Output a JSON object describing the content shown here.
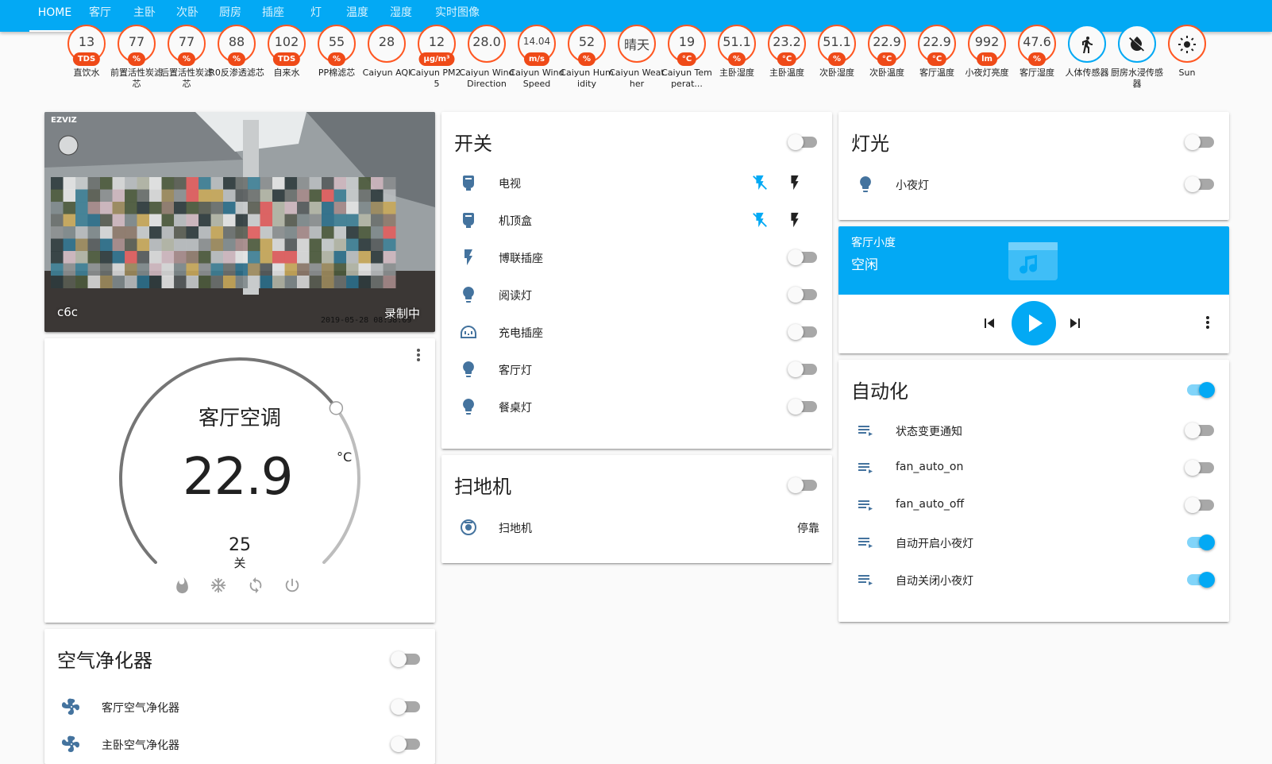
{
  "tabs": [
    "HOME",
    "客厅",
    "主卧",
    "次卧",
    "厨房",
    "插座",
    "灯",
    "温度",
    "湿度",
    "实时图像"
  ],
  "badges": [
    {
      "value": "13",
      "unit": "TDS",
      "label": "直饮水"
    },
    {
      "value": "77",
      "unit": "%",
      "label": "前置活性炭滤芯"
    },
    {
      "value": "77",
      "unit": "%",
      "label": "后置活性炭滤芯"
    },
    {
      "value": "88",
      "unit": "%",
      "label": "R0反渗透滤芯"
    },
    {
      "value": "102",
      "unit": "TDS",
      "label": "自来水"
    },
    {
      "value": "55",
      "unit": "%",
      "label": "PP棉滤芯"
    },
    {
      "value": "28",
      "unit": "",
      "label": "Caiyun AQI"
    },
    {
      "value": "12",
      "unit": "μg/m³",
      "label": "Caiyun PM2.5"
    },
    {
      "value": "28.0",
      "unit": "",
      "label": "Caiyun Wind Direction"
    },
    {
      "value": "14.04",
      "unit": "m/s",
      "label": "Caiyun Wind Speed"
    },
    {
      "value": "52",
      "unit": "%",
      "label": "Caiyun Humidity"
    },
    {
      "value": "晴天",
      "unit": "",
      "label": "Caiyun Weather"
    },
    {
      "value": "19",
      "unit": "°C",
      "label": "Caiyun Temperat..."
    },
    {
      "value": "51.1",
      "unit": "%",
      "label": "主卧湿度"
    },
    {
      "value": "23.2",
      "unit": "°C",
      "label": "主卧温度"
    },
    {
      "value": "51.1",
      "unit": "%",
      "label": "次卧湿度"
    },
    {
      "value": "22.9",
      "unit": "°C",
      "label": "次卧温度"
    },
    {
      "value": "22.9",
      "unit": "°C",
      "label": "客厅温度"
    },
    {
      "value": "992",
      "unit": "lm",
      "label": "小夜灯亮度"
    },
    {
      "value": "47.6",
      "unit": "%",
      "label": "客厅湿度"
    },
    {
      "value": "",
      "unit": "",
      "label": "人体传感器",
      "icon": "walk-icon"
    },
    {
      "value": "",
      "unit": "",
      "label": "厨房水浸传感器",
      "icon": "water-off-icon"
    },
    {
      "value": "",
      "unit": "",
      "label": "Sun",
      "icon": "sun-icon"
    }
  ],
  "camera": {
    "name": "c6c",
    "recording": "录制中",
    "timestamp": "2019-05-28 08:58:09",
    "brand": "EZVIZ"
  },
  "climate": {
    "name": "客厅空调",
    "current": "22.9",
    "unit": "°C",
    "target": "25",
    "mode": "关",
    "target_fraction": 0.7
  },
  "switches": {
    "title": "开关",
    "items": [
      {
        "label": "电视",
        "icon": "tv-icon",
        "type": "buttons"
      },
      {
        "label": "机顶盒",
        "icon": "settop-icon",
        "type": "buttons"
      },
      {
        "label": "博联插座",
        "icon": "flash-icon",
        "type": "toggle"
      },
      {
        "label": "阅读灯",
        "icon": "bulb-icon",
        "type": "toggle"
      },
      {
        "label": "充电插座",
        "icon": "socket-icon",
        "type": "toggle"
      },
      {
        "label": "客厅灯",
        "icon": "bulb-icon",
        "type": "toggle"
      },
      {
        "label": "餐桌灯",
        "icon": "bulb-icon",
        "type": "toggle"
      }
    ]
  },
  "vacuum": {
    "title": "扫地机",
    "items": [
      {
        "label": "扫地机",
        "state": "停靠"
      }
    ]
  },
  "purifier": {
    "title": "空气净化器",
    "items": [
      {
        "label": "客厅空气净化器"
      },
      {
        "label": "主卧空气净化器"
      }
    ]
  },
  "lights": {
    "title": "灯光",
    "items": [
      {
        "label": "小夜灯"
      }
    ]
  },
  "media": {
    "name": "客厅小度",
    "state": "空闲"
  },
  "automation": {
    "title": "自动化",
    "items": [
      {
        "label": "状态变更通知",
        "on": false
      },
      {
        "label": "fan_auto_on",
        "on": false
      },
      {
        "label": "fan_auto_off",
        "on": false
      },
      {
        "label": "自动开启小夜灯",
        "on": true
      },
      {
        "label": "自动关闭小夜灯",
        "on": true
      }
    ]
  },
  "colors": {
    "primary": "#03a9f4",
    "badge_red": "#ef4a18",
    "icon_blue": "#44739e"
  }
}
